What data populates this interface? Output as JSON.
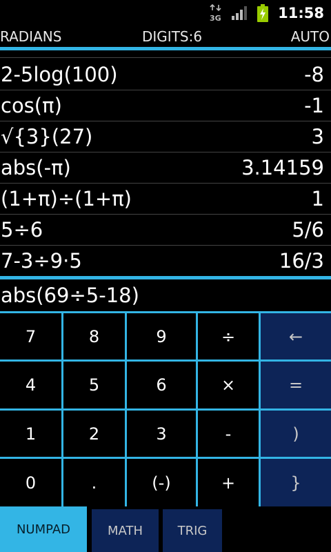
{
  "status_bar": {
    "network": "3G",
    "time": "11:58",
    "icons": [
      "3g-data-icon",
      "signal-icon",
      "battery-charging-icon"
    ]
  },
  "mode_bar": {
    "angle_mode": "RADIANS",
    "digits": "DIGITS:6",
    "display_mode": "AUTO"
  },
  "history": [
    {
      "expr": "2-5log(100)",
      "result": "-8"
    },
    {
      "expr": "cos(π)",
      "result": "-1"
    },
    {
      "expr": "√{3}(27)",
      "result": "3"
    },
    {
      "expr": "abs(-π)",
      "result": "3.14159"
    },
    {
      "expr": "(1+π)÷(1+π)",
      "result": "1"
    },
    {
      "expr": "5÷6",
      "result": "5/6"
    },
    {
      "expr": "7-3÷9·5",
      "result": "16/3"
    }
  ],
  "input": {
    "value": "abs(69÷5-18)"
  },
  "keypad": {
    "rows": [
      [
        "7",
        "8",
        "9",
        "÷",
        "←"
      ],
      [
        "4",
        "5",
        "6",
        "×",
        "="
      ],
      [
        "1",
        "2",
        "3",
        "-",
        ")"
      ],
      [
        "0",
        ".",
        "(-)",
        "+",
        "}"
      ]
    ]
  },
  "tabs": [
    {
      "label": "NUMPAD",
      "active": true
    },
    {
      "label": "MATH",
      "active": false
    },
    {
      "label": "TRIG",
      "active": false
    }
  ],
  "colors": {
    "accent": "#33b5e5",
    "function_key": "#0d2457",
    "background": "#000000"
  }
}
